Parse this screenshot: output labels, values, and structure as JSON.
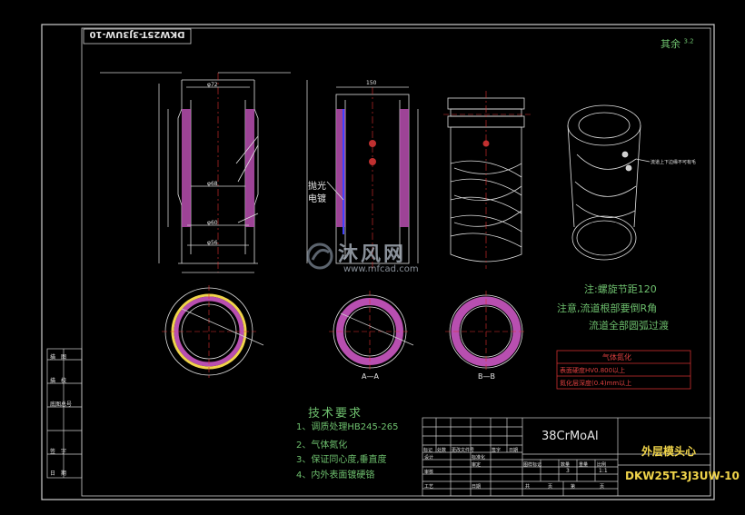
{
  "drawing": {
    "code_rotated": "DKW25T-3J3UW-10",
    "roughness_label": "其余",
    "roughness_value": "3.2"
  },
  "views": {
    "section_left_labels": [
      "φ72",
      "φ68",
      "φ60",
      "φ56"
    ],
    "polish_label_1": "抛光",
    "polish_label_2": "电镀",
    "dim_top": "150",
    "section_aa": "A—A",
    "section_bb": "B—B",
    "iso_note": "流道上下边缘不可有毛"
  },
  "notes": {
    "n1": "注:螺旋节距120",
    "n2": "注意,流道根部要倒R角",
    "n3": "流道全部圆弧过渡"
  },
  "nitride_box": {
    "title": "气体氮化",
    "line1": "表面硬度HV0.800以上",
    "line2": "氮化层深度(0.4)mm以上"
  },
  "tech": {
    "title": "技术要求",
    "items": [
      "1、调质处理HB245-265",
      "2、气体氮化",
      "3、保证同心度,垂直度",
      "4、内外表面镀硬铬"
    ]
  },
  "side_labels": [
    "描　图",
    "描　校",
    "底图总号",
    "签　字",
    "日　期"
  ],
  "title_block": {
    "material": "38CrMoAl",
    "part_name": "外层模头心",
    "drawing_no": "DKW25T-3J3UW-10",
    "scale": "1:1",
    "sheets": "3",
    "labels": [
      "标记",
      "处数",
      "更改文件号",
      "签字",
      "日期",
      "设计",
      "标准化",
      "审核",
      "审定",
      "工艺",
      "日期",
      "图样标记",
      "数量",
      "重量",
      "比例",
      "共",
      "页",
      "第",
      "页"
    ]
  },
  "watermark": {
    "brand": "沐风网",
    "url": "www.mfcad.com"
  }
}
